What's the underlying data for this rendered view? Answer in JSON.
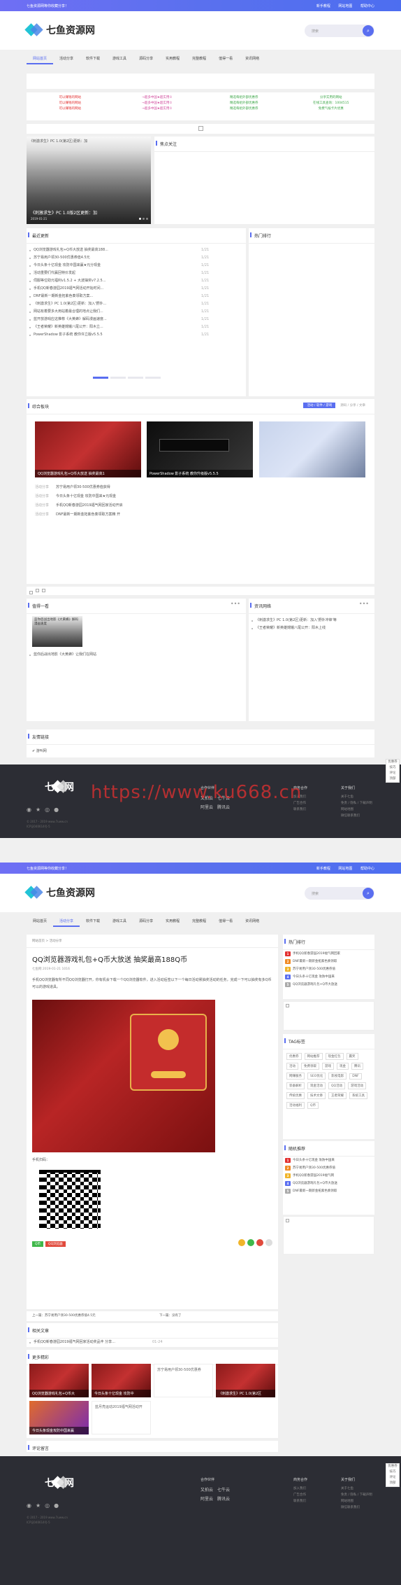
{
  "top_bar": {
    "notice": "七鱼资源网等你收藏分享！",
    "links": "新手教程 网站地图 帮助中心"
  },
  "logo_text": "七鱼资源网",
  "search": {
    "placeholder": "搜索",
    "icon": "search-icon"
  },
  "nav": [
    "网站首页",
    "活动分享",
    "软件下载",
    "游戏工具",
    "源码分享",
    "实用教程",
    "完整教程",
    "值得一看",
    "资讯网络"
  ],
  "home": {
    "friend_links": [
      [
        "可以赚钱的网站",
        "→超多中国★超实用①",
        "精选每组外部优惠券",
        "分享实用的网站",
        "网赚主播支持，最有价值"
      ],
      [
        "可以赚钱的网站",
        "→超多中国★超实用①",
        "精选每组外部优惠券",
        "在线工具查询：1004515",
        "网赚主播支持，最有价值"
      ],
      [
        "可以赚钱的网站",
        "→超多中国★超实用①",
        "精选每组外部优惠券",
        "免费气候卡片优惠",
        "网赚主播支持，最有价值"
      ]
    ],
    "slider_caption": "《刺激求生》PC 1.0版2区更新：加",
    "slider_date": "2019-01-21",
    "slider_title_small": "《刺激求生》PC 1.0(第2区)更新：加",
    "hot_focus_title": "焦点关注",
    "recent_title": "最近更新",
    "recent": [
      [
        "QQ浏览器游戏礼包+Q币大放送 抽奖最高188...",
        "1/21"
      ],
      [
        "苏宁易用户领30-500优惠券值4.5元",
        "1/21"
      ],
      [
        "今日头条十亿现金 攻防中国来赢★元分现金",
        "1/21"
      ],
      [
        "活动重要们代赢回特价发起",
        "1/21"
      ],
      [
        "伺服等位助元福利v1.5.2 + 大波抽奖v7.2.5...",
        "1/21"
      ],
      [
        "手机QQ新春游园2019福气网活动开始时间...",
        "1/21"
      ],
      [
        "DNF最新一期新金拓紫色奏领取方案...",
        "1/21"
      ],
      [
        "《刺激求生》PC 1.0(第2区)更新：加入'野外...",
        "1/21"
      ],
      [
        "网站有着要多大用站着最合理的地点让我们...",
        "1/21"
      ],
      [
        "蓝开放游戏应这推荐《大黄蜂》解码漫画速度...",
        "1/21"
      ],
      [
        "《王者荣耀》新英雄嫦娥八尾公开：阳木立...",
        "1/21"
      ],
      [
        "PowerShadow 影子系统 教你许立版v5.5.5",
        "1/21"
      ]
    ],
    "hot_rank_title": "热门排行",
    "combo_title": "综合板块",
    "combo_tabs": [
      "活动 / 软件 / 游戏",
      "源码 / 分享 / 文章"
    ],
    "combo_cards": [
      "QQ浏览器游戏礼包+Q币大放送 抽奖最高1",
      "PowerShadow 影子系统 教你升级版v5.5.5",
      ""
    ],
    "combo_rows": [
      [
        "活动分享",
        "苏宁易用户领30-500优惠券值获得"
      ],
      [
        "活动分享",
        "今日头条十亿现金 攻防中国来★元现金"
      ],
      [
        "活动分享",
        "手机QQ新春游园2019福气网回家活动开启"
      ],
      [
        "活动分享",
        "DNF最新一期新金拓紫色奏领取方案精 开"
      ]
    ],
    "worth_title": "值得一看",
    "worth_card": "蓝你后战出地影《大黄蜂》解码漫画速度",
    "worth_item": "蓝你后战出地影《大黄蜂》让我们在网站",
    "news_title": "资讯网络",
    "news": [
      "《刺激求生》PC 1.0(第2区)更新：加入'野外冲锋'等",
      "《王者荣耀》新英雄嫦娥八尾公开：阳木上线"
    ],
    "friend_title": "友情链接",
    "friend_item": "游叫网"
  },
  "footer": {
    "logo_text": "七鱼网",
    "copyright": "© 2017 - 2019 www.7uww.cn",
    "copyright2": "ICP证040614号-5",
    "cooperate_title": "合作伙伴",
    "partners": [
      "又拍云",
      "七牛云",
      "阿里云",
      "腾讯云"
    ],
    "business_title": "商务合作",
    "business": [
      "加入我们",
      "广告合作",
      "联系我们"
    ],
    "about_title": "关于我们",
    "about": [
      "关于七鱼",
      "免责 / 隐私 / 下载声明",
      "网站地图",
      "微信联系我们"
    ],
    "watermark": "https://www.ku668.cn"
  },
  "article": {
    "breadcrumb": "网站首页 > 活动分享",
    "title": "QQ浏览器游戏礼包+Q币大放送 抽奖最高188Q币",
    "meta": "七鱼网   2019-01-21   1016",
    "body": "手机QQ浏览器有所不同QQ浏览器打开，你有机会下载一个QQ浏览器软件，进入活动后签以下一个每日活动累抽奖活动的任务，完成一下可以抽奖有多Q币可以的游戏道具。",
    "qr_label": "手机扫码：",
    "tags": [
      "Q币",
      "QQ浏览器"
    ],
    "prev": "上一篇：苏宁易用户领30-500优惠券值4.5元",
    "next": "下一篇：没有了",
    "related_title": "相关文章",
    "related": "手机QQ新春游园2019福气网回家活动奖品丰 分享...",
    "related_date": "01-24",
    "more_title": "更多精彩",
    "more_cards": [
      "QQ浏览器游戏礼包+Q币大",
      "今日头条十亿现金 攻防中",
      "苏宁易用户领30-500优惠券",
      "《刺激求生》PC 1.0(第2区",
      "今日头条现金攻防中国来赢",
      "蓝月亮运动2019福气网活动开"
    ],
    "comments_title": "评论留言"
  },
  "side": {
    "hot_title": "热门排行",
    "hot": [
      "手机QQ新春游园2019福气网回家",
      "DNF最新一期新金拓紫色奏领取",
      "苏宁易用户领30-500优惠券值",
      "今日头条十亿现金 攻防中国来",
      "QQ浏览器游戏礼包+Q币大放送"
    ],
    "tags_title": "TAG标签",
    "tags": [
      "优惠券",
      "网站推荐",
      "现金红包",
      "赢奖",
      "活动",
      "免费领取",
      "游戏",
      "现金",
      "腾讯",
      "网赚服务",
      "SEO优化",
      "影视电影",
      "DNF",
      "装备解析",
      "现金活动",
      "QQ活动",
      "游戏活动",
      "传统优惠",
      "技术文章",
      "王者荣耀",
      "系统工具",
      "活动福利",
      "Q币"
    ],
    "random_title": "随机推荐",
    "random": [
      "今日头条十亿现金 攻防中国来",
      "苏宁易用户领30-500优惠券值",
      "手机QQ新春游园2019福气网",
      "QQ浏览器游戏礼包+Q币大放送",
      "DNF最新一期新金拓紫色奏领取"
    ]
  },
  "float_buttons": [
    "优惠券",
    "技巧",
    "评论",
    "顶部"
  ],
  "colors": {
    "accent": "#5a6ef0",
    "footer": "#2c2d34",
    "watermark": "#e23030"
  }
}
